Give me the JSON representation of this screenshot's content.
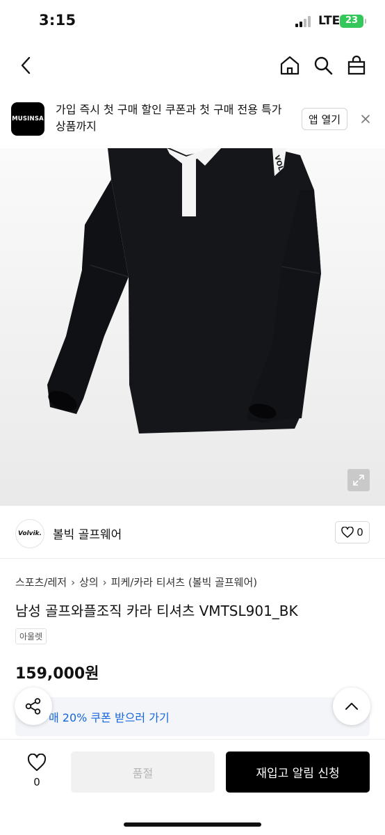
{
  "status_bar": {
    "time": "3:15",
    "network": "LTE",
    "battery": "23"
  },
  "nav": {
    "back_icon": "chevron-left-icon",
    "home_icon": "home-icon",
    "search_icon": "search-icon",
    "cart_icon": "shopping-bag-icon"
  },
  "banner": {
    "logo_text": "MUSINSA",
    "message": "가입 즉시 첫 구매 할인 쿠폰과 첫 구매 전용 특가 상품까지",
    "open_label": "앱 열기"
  },
  "hero": {
    "shirt_logo": "VOL"
  },
  "brand": {
    "logo_text": "Volvik.",
    "name": "볼빅 골프웨어",
    "like_count": "0"
  },
  "breadcrumb": [
    "스포츠/레저",
    "상의",
    "피케/카라 티셔츠 (볼빅 골프웨어)"
  ],
  "product": {
    "title": "남성 골프와플조직 카라 티셔츠 VMTSL901_BK",
    "badge": "아울렛",
    "price": "159,000원"
  },
  "coupon": {
    "text": "매 20% 쿠폰 받으러 가기"
  },
  "bottom_bar": {
    "wish_count": "0",
    "soldout_label": "품절",
    "notify_label": "재입고 알림 신청"
  },
  "colors": {
    "accent_link": "#1666e0",
    "primary_button": "#000000",
    "battery": "#34c759"
  }
}
